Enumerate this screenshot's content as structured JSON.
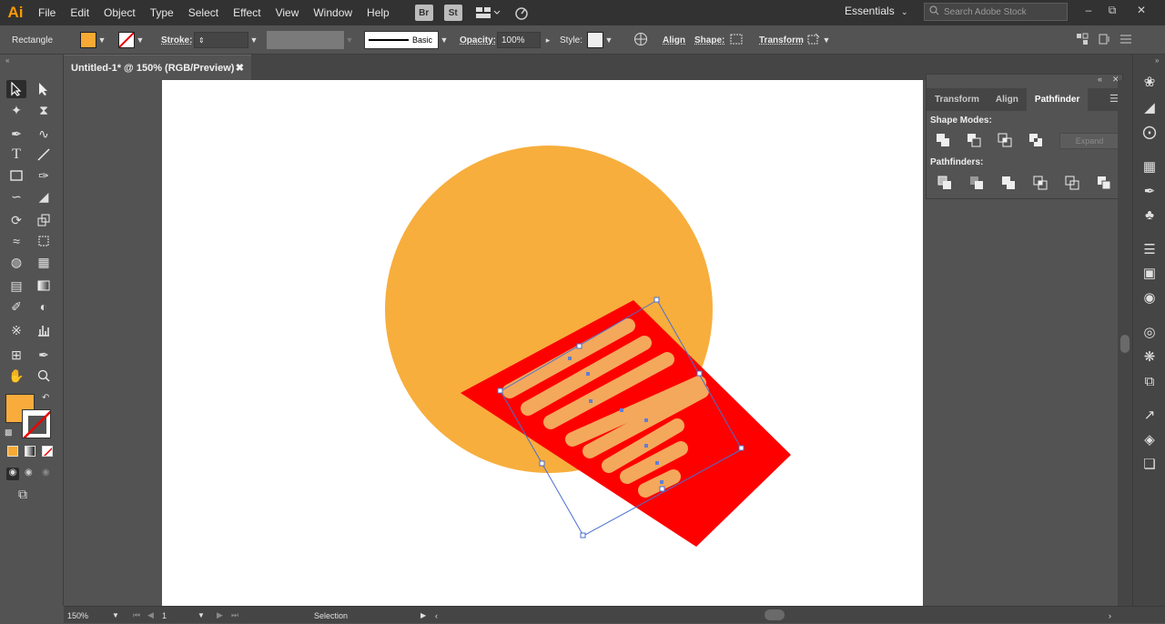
{
  "app": {
    "logo": "Ai"
  },
  "menu": [
    "File",
    "Edit",
    "Object",
    "Type",
    "Select",
    "Effect",
    "View",
    "Window",
    "Help"
  ],
  "bridge": {
    "br": "Br",
    "st": "St"
  },
  "workspace": {
    "label": "Essentials"
  },
  "search": {
    "placeholder": "Search Adobe Stock"
  },
  "control": {
    "object_type": "Rectangle",
    "stroke_label": "Stroke:",
    "brush_label": "Basic",
    "opacity_label": "Opacity:",
    "opacity_value": "100%",
    "style_label": "Style:",
    "align_label": "Align",
    "shape_label": "Shape:",
    "transform_label": "Transform",
    "fill_color": "#f7a934"
  },
  "document": {
    "tab_title": "Untitled-1* @ 150% (RGB/Preview)"
  },
  "panel": {
    "tabs": [
      "Transform",
      "Align",
      "Pathfinder"
    ],
    "active_tab": "Pathfinder",
    "shape_modes_label": "Shape Modes:",
    "pathfinders_label": "Pathfinders:",
    "expand_label": "Expand"
  },
  "status": {
    "zoom": "150%",
    "artboard": "1",
    "tool": "Selection"
  },
  "colors": {
    "orange": "#f7ae3c",
    "red": "#ff0000",
    "selection": "#4a6fd0"
  }
}
